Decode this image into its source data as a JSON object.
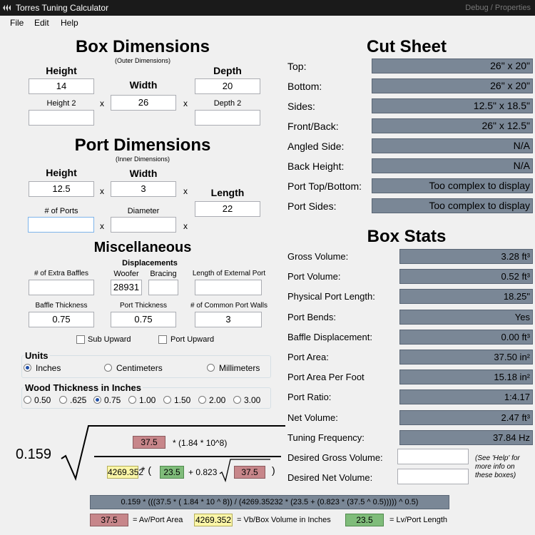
{
  "window": {
    "title": "Torres Tuning Calculator",
    "right_text": "Debug / Properties"
  },
  "menu": {
    "file": "File",
    "edit": "Edit",
    "help": "Help"
  },
  "box": {
    "title": "Box Dimensions",
    "subtitle": "(Outer Dimensions)",
    "height_label": "Height",
    "height": "14",
    "width_label": "Width",
    "width": "26",
    "depth_label": "Depth",
    "depth": "20",
    "height2_label": "Height 2",
    "height2": "",
    "depth2_label": "Depth 2",
    "depth2": "",
    "x": "x"
  },
  "port": {
    "title": "Port Dimensions",
    "subtitle": "(Inner Dimensions)",
    "height_label": "Height",
    "height": "12.5",
    "width_label": "Width",
    "width": "3",
    "length_label": "Length",
    "length": "22",
    "num_ports_label": "# of Ports",
    "num_ports": "",
    "diameter_label": "Diameter",
    "diameter": ""
  },
  "misc": {
    "title": "Miscellaneous",
    "extra_baffles_label": "# of Extra Baffles",
    "extra_baffles": "",
    "displacements_label": "Displacements",
    "woofer_label": "Woofer",
    "woofer": "28931",
    "bracing_label": "Bracing",
    "bracing": "",
    "ext_port_label": "Length of External Port",
    "ext_port": "",
    "baffle_thickness_label": "Baffle Thickness",
    "baffle_thickness": "0.75",
    "port_thickness_label": "Port Thickness",
    "port_thickness": "0.75",
    "common_walls_label": "# of Common Port Walls",
    "common_walls": "3",
    "sub_upward_label": "Sub Upward",
    "port_upward_label": "Port Upward"
  },
  "units": {
    "title": "Units",
    "inches": "Inches",
    "centimeters": "Centimeters",
    "millimeters": "Millimeters",
    "selected": "Inches"
  },
  "wood": {
    "title": "Wood Thickness in Inches",
    "options": [
      "0.50",
      ".625",
      "0.75",
      "1.00",
      "1.50",
      "2.00",
      "3.00"
    ],
    "selected": "0.75"
  },
  "cut_sheet": {
    "title": "Cut Sheet",
    "rows": [
      {
        "label": "Top:",
        "value": "26\" x 20\""
      },
      {
        "label": "Bottom:",
        "value": "26\" x 20\""
      },
      {
        "label": "Sides:",
        "value": "12.5\" x 18.5\""
      },
      {
        "label": "Front/Back:",
        "value": "26\" x 12.5\""
      },
      {
        "label": "Angled Side:",
        "value": "N/A"
      },
      {
        "label": "Back Height:",
        "value": "N/A"
      },
      {
        "label": "Port Top/Bottom:",
        "value": "Too complex to display"
      },
      {
        "label": "Port Sides:",
        "value": "Too complex to display"
      }
    ]
  },
  "stats": {
    "title": "Box Stats",
    "rows": [
      {
        "label": "Gross Volume:",
        "value": "3.28 ft³"
      },
      {
        "label": "Port Volume:",
        "value": "0.52 ft³"
      },
      {
        "label": "Physical Port Length:",
        "value": "18.25\""
      },
      {
        "label": "Port Bends:",
        "value": "Yes"
      },
      {
        "label": "Baffle Displacement:",
        "value": "0.00 ft³"
      },
      {
        "label": "Port Area:",
        "value": "37.50 in²"
      },
      {
        "label": "Port Area Per Foot",
        "value": "15.18 in²"
      },
      {
        "label": "Port Ratio:",
        "value": "1:4.17"
      },
      {
        "label": "Net Volume:",
        "value": "2.47 ft³"
      },
      {
        "label": "Tuning Frequency:",
        "value": "37.84 Hz"
      }
    ],
    "desired_gross_label": "Desired Gross Volume:",
    "desired_gross": "",
    "desired_net_label": "Desired Net Volume:",
    "desired_net": "",
    "help_note_1": "(See 'Help' for",
    "help_note_2": "more info on",
    "help_note_3": "these boxes)"
  },
  "formula": {
    "constant": "0.159",
    "av": "37.5",
    "times_const": "* (1.84 * 10^8)",
    "vb": "4269.352",
    "star_paren": "* (",
    "lv": "23.5",
    "plus_const": "+ 0.823",
    "av2": "37.5",
    "close": ")",
    "expression": "0.159 * (((37.5 * ( 1.84 * 10 ^ 8)) / (4269.35232 * (23.5 + (0.823 * (37.5 ^ 0.5))))) ^ 0.5)",
    "legend_av": "37.5",
    "legend_av_label": "= Av/Port Area",
    "legend_vb": "4269.352",
    "legend_vb_label": "= Vb/Box Volume in Inches",
    "legend_lv": "23.5",
    "legend_lv_label": "= Lv/Port Length"
  }
}
